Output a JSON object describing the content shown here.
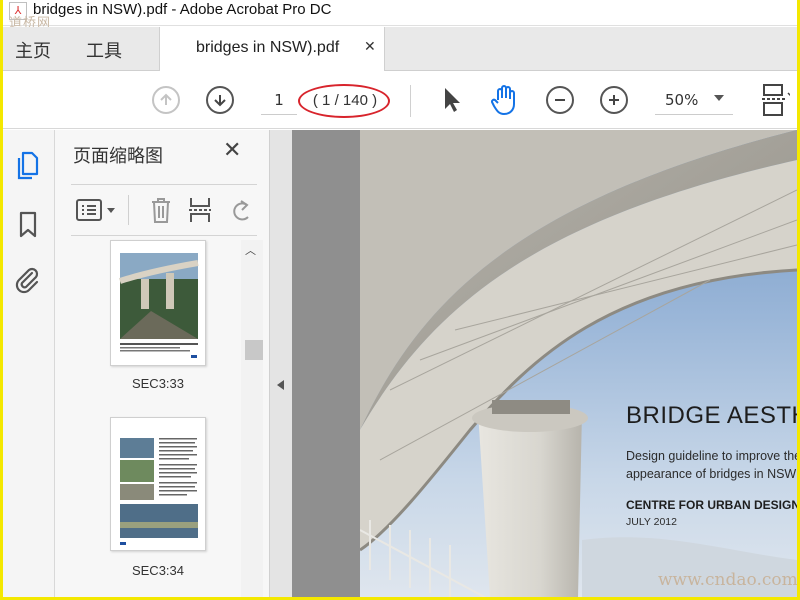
{
  "window": {
    "title": "bridges in NSW).pdf - Adobe Acrobat Pro DC",
    "watermark_top": "道桥网",
    "watermark_bottom": "www.cndao.com"
  },
  "tabs": {
    "home": "主页",
    "tools": "工具",
    "document": "bridges in NSW).pdf",
    "close": "✕"
  },
  "toolbar": {
    "page_current": "1",
    "page_count": "( 1 / 140 )",
    "zoom": "50%"
  },
  "thumbnail_panel": {
    "title": "页面缩略图",
    "close": "✕",
    "thumbnails": [
      {
        "label": "SEC3:33"
      },
      {
        "label": "SEC3:34"
      }
    ]
  },
  "document": {
    "heading": "BRIDGE AESTHETICS",
    "subtitle_line1": "Design guideline to improve the",
    "subtitle_line2": "appearance of bridges in NSW",
    "organization": "CENTRE FOR URBAN DESIGN",
    "date": "JULY 2012"
  },
  "colors": {
    "accent": "#1473e6",
    "highlight_ellipse": "#d8242c",
    "border": "#f4e800"
  }
}
